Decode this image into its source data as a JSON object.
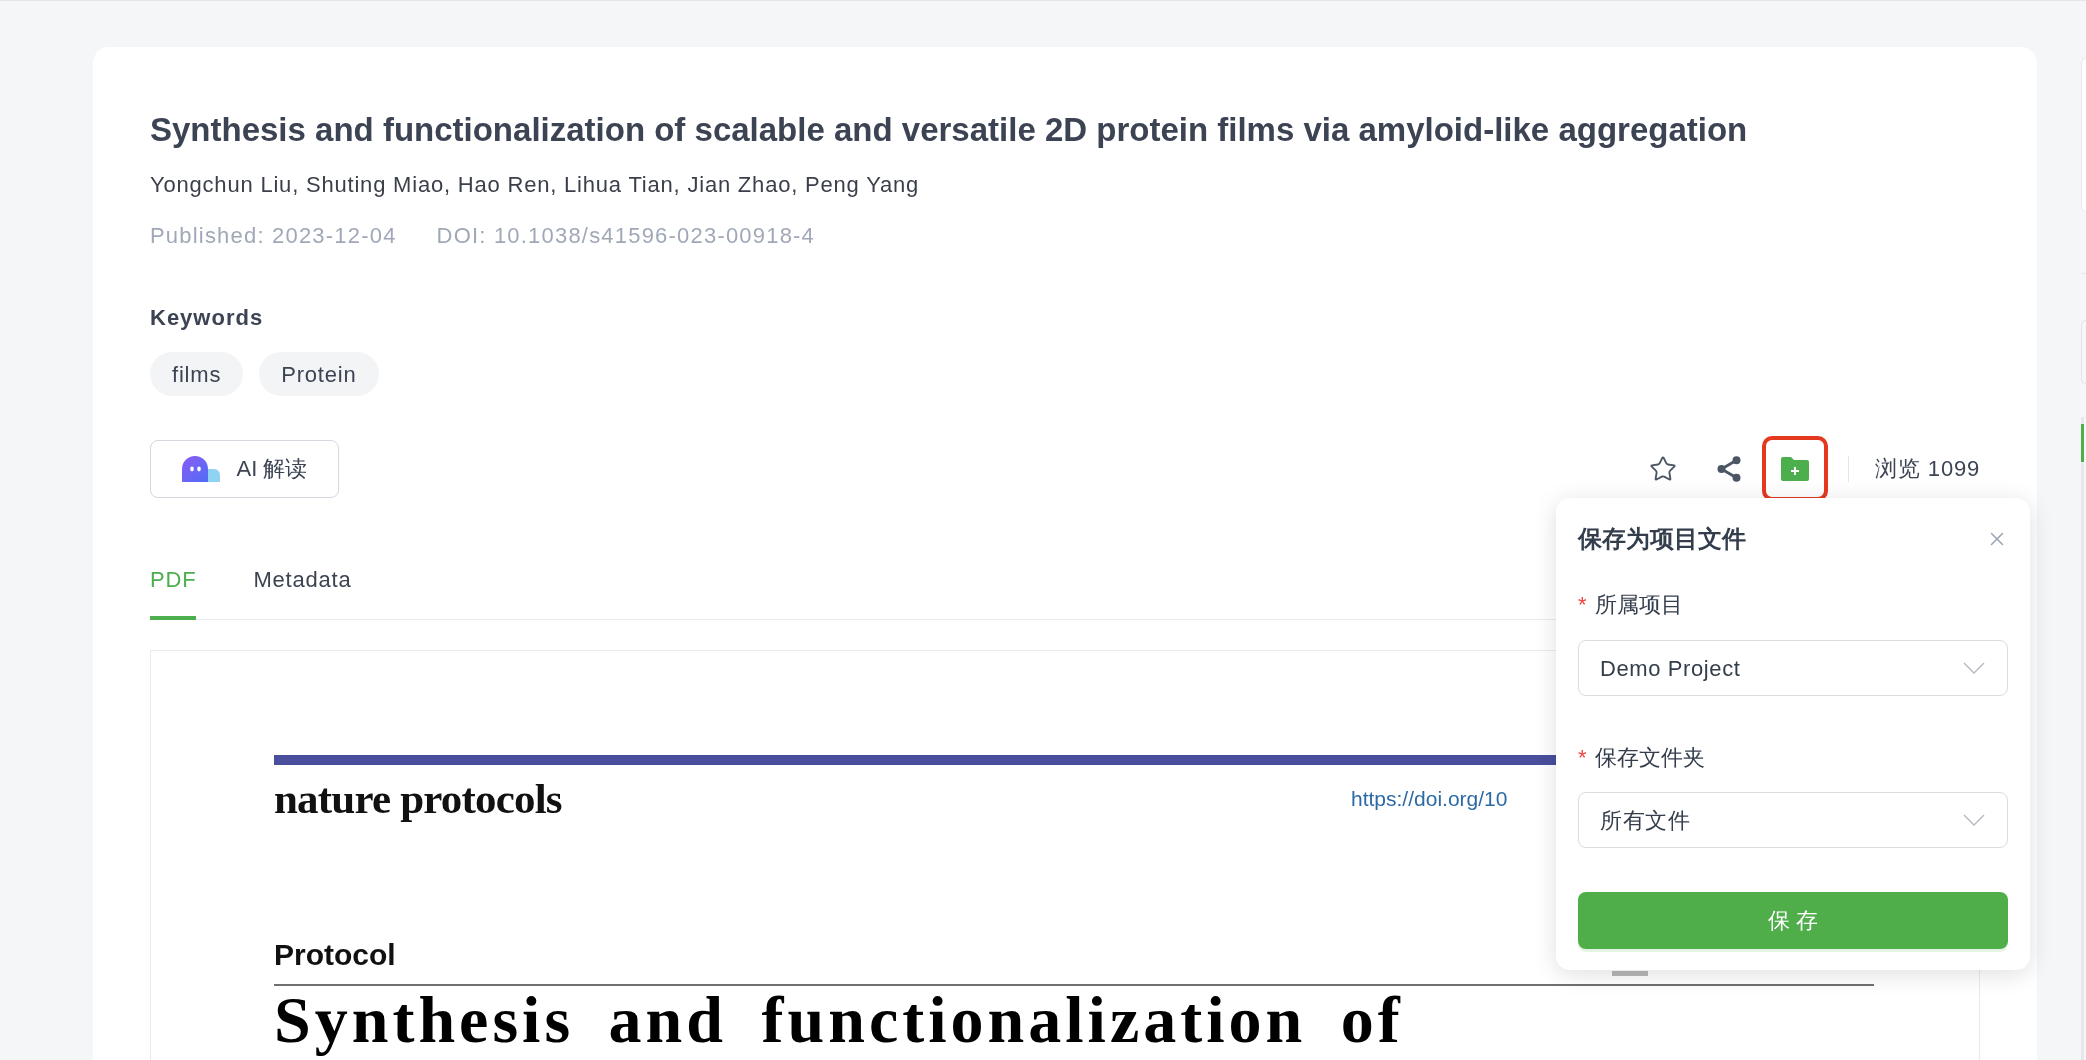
{
  "article": {
    "title": "Synthesis and functionalization of scalable and versatile 2D protein films via amyloid-like aggregation",
    "authors": "Yongchun Liu, Shuting Miao, Hao Ren, Lihua Tian, Jian Zhao, Peng Yang",
    "published": "Published: 2023-12-04",
    "doi": "DOI: 10.1038/s41596-023-00918-4"
  },
  "keywords": {
    "heading": "Keywords",
    "tags": [
      "films",
      "Protein"
    ]
  },
  "ai_button": {
    "label": "AI 解读"
  },
  "actions": [
    {
      "kind": "star",
      "highlighted": false
    },
    {
      "kind": "share",
      "highlighted": false
    },
    {
      "kind": "folder_add",
      "highlighted": true
    }
  ],
  "views": "浏览 1099",
  "tabs": [
    {
      "label": "PDF",
      "selected": true
    },
    {
      "label": "Metadata",
      "selected": false
    }
  ],
  "pdf_page": {
    "journal": "nature protocols",
    "doi_link": "https://doi.org/10",
    "section": "Protocol",
    "heading": "Synthesis and functionalization of"
  },
  "save_popup": {
    "title": "保存为项目文件",
    "fields": [
      {
        "marker": "*",
        "label": "所属项目",
        "value": "Demo Project"
      },
      {
        "marker": "*",
        "label": "保存文件夹",
        "value": "所有文件"
      }
    ],
    "button": "保 存"
  }
}
